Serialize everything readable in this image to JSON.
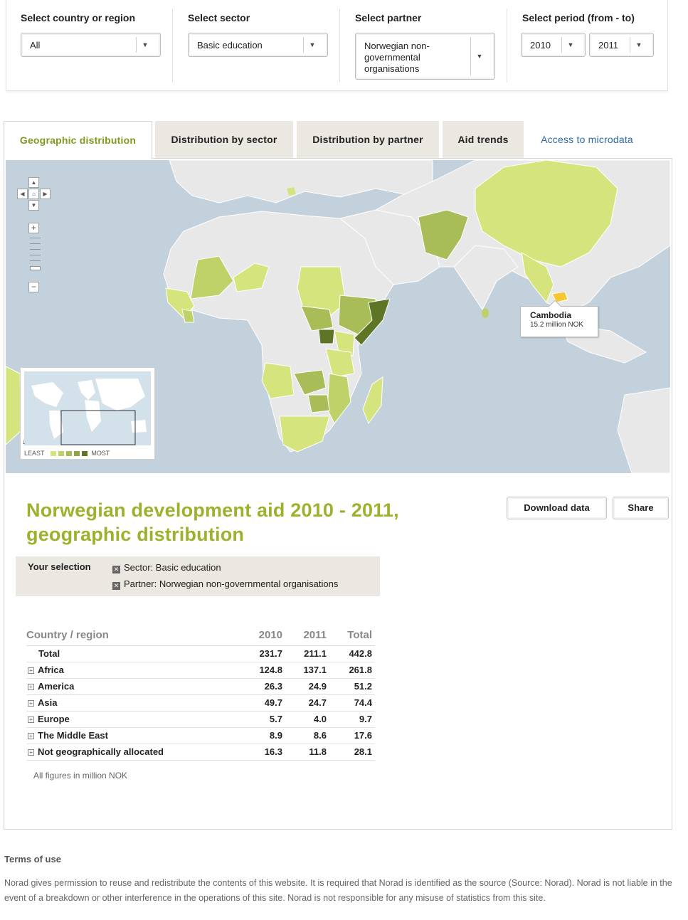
{
  "filters": {
    "country": {
      "label": "Select country or region",
      "value": "All"
    },
    "sector": {
      "label": "Select sector",
      "value": "Basic education"
    },
    "partner": {
      "label": "Select partner",
      "value_lines": [
        "Norwegian non-",
        "governmental",
        "organisations"
      ]
    },
    "period": {
      "label": "Select period (from - to)",
      "from": "2010",
      "to": "2011"
    }
  },
  "tabs": [
    "Geographic distribution",
    "Distribution by sector",
    "Distribution by partner",
    "Aid trends"
  ],
  "tab_link": "Access to microdata",
  "map": {
    "tooltip": {
      "name": "Cambodia",
      "value": "15.2 million NOK"
    },
    "legend": {
      "least": "LEAST",
      "most": "MOST",
      "colors": [
        "#d6e47e",
        "#bfd26a",
        "#a8bc58",
        "#8ea548",
        "#5e7526"
      ]
    },
    "colors": {
      "sea": "#c2d1dc",
      "land": "#e8e8e8",
      "highlight": "#f5c730"
    }
  },
  "title_lines": [
    "Norwegian development aid 2010 - 2011,",
    "geographic distribution"
  ],
  "buttons": {
    "download": "Download data",
    "share": "Share"
  },
  "selection": {
    "label": "Your selection",
    "items": [
      "Sector: Basic education",
      "Partner: Norwegian non-governmental organisations"
    ]
  },
  "table": {
    "headers": [
      "Country / region",
      "2010",
      "2011",
      "Total"
    ],
    "rows": [
      {
        "name": "Total",
        "expandable": false,
        "v2010": "231.7",
        "v2011": "211.1",
        "total": "442.8"
      },
      {
        "name": "Africa",
        "expandable": true,
        "v2010": "124.8",
        "v2011": "137.1",
        "total": "261.8"
      },
      {
        "name": "America",
        "expandable": true,
        "v2010": "26.3",
        "v2011": "24.9",
        "total": "51.2"
      },
      {
        "name": "Asia",
        "expandable": true,
        "v2010": "49.7",
        "v2011": "24.7",
        "total": "74.4"
      },
      {
        "name": "Europe",
        "expandable": true,
        "v2010": "5.7",
        "v2011": "4.0",
        "total": "9.7"
      },
      {
        "name": "The Middle East",
        "expandable": true,
        "v2010": "8.9",
        "v2011": "8.6",
        "total": "17.6"
      },
      {
        "name": "Not geographically allocated",
        "expandable": true,
        "v2010": "16.3",
        "v2011": "11.8",
        "total": "28.1"
      }
    ],
    "note": "All figures in million NOK"
  },
  "terms": {
    "heading": "Terms of use",
    "text": "Norad gives permission to reuse and redistribute the contents of this website. It is required that Norad is identified as the source (Source: Norad). Norad is not liable in the event of a breakdown or other interference in the operations of this site. Norad is not responsible for any misuse of statistics from this site."
  },
  "icons": {
    "dropdown": "triangle-down-icon",
    "expand": "plus-box-icon",
    "remove": "x-box-icon"
  }
}
